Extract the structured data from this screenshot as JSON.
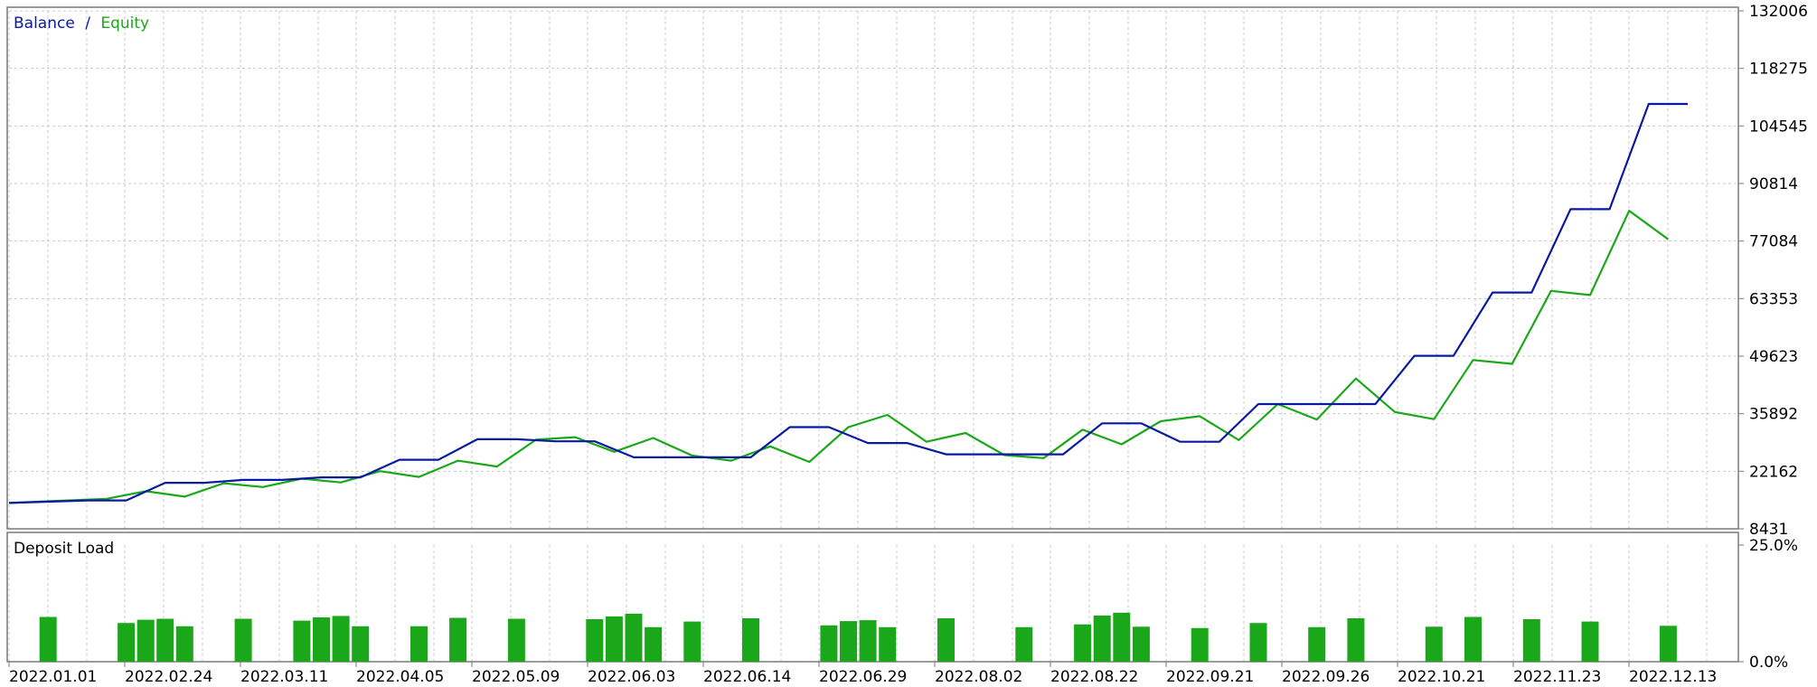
{
  "colors": {
    "balance": "#0a1aa0",
    "equity": "#1aa81a",
    "bar": "#1aa81a",
    "grid": "#c8c8c8",
    "frame": "#7a7a7a",
    "text": "#000000"
  },
  "chart_data": [
    {
      "type": "line",
      "legend": {
        "placement": "top-left",
        "items": [
          {
            "label": "Balance",
            "color": "#0a1aa0"
          },
          {
            "label": "/",
            "color": "#0a1aa0"
          },
          {
            "label": "Equity",
            "color": "#1aa81a"
          }
        ]
      },
      "grid": true,
      "ylim": [
        8431,
        132006
      ],
      "y_ticks": [
        "132006",
        "118275",
        "104545",
        "90814",
        "77084",
        "63353",
        "49623",
        "35892",
        "22162",
        "8431"
      ],
      "x_ticks": [
        "2022.01.01",
        "2022.02.24",
        "2022.03.11",
        "2022.04.05",
        "2022.05.09",
        "2022.06.03",
        "2022.06.14",
        "2022.06.29",
        "2022.08.02",
        "2022.08.22",
        "2022.09.21",
        "2022.09.26",
        "2022.10.21",
        "2022.11.23",
        "2022.12.13"
      ],
      "series": [
        {
          "name": "Balance",
          "x": [
            0,
            4,
            6,
            8,
            10,
            12,
            14,
            16,
            18,
            20,
            22,
            24,
            26,
            28,
            30,
            32,
            34,
            36,
            38,
            40,
            42,
            44,
            46,
            48,
            50,
            52,
            54,
            56,
            58,
            60,
            62,
            64,
            66,
            68,
            70,
            72,
            74,
            76,
            78,
            80,
            82,
            84,
            86
          ],
          "y": [
            14600,
            15200,
            15200,
            19400,
            19400,
            20100,
            20100,
            20700,
            20700,
            24900,
            24900,
            29800,
            29800,
            29300,
            29300,
            25500,
            25500,
            25500,
            25500,
            32700,
            32700,
            28900,
            28900,
            26200,
            26200,
            26200,
            26200,
            33600,
            33600,
            29200,
            29200,
            38200,
            38200,
            38200,
            38200,
            49700,
            49700,
            64800,
            64800,
            84700,
            84700,
            109800,
            109800
          ],
          "color": "#0a1aa0"
        },
        {
          "name": "Equity",
          "x": [
            0,
            2,
            5,
            7,
            9,
            11,
            13,
            15,
            17,
            19,
            21,
            23,
            25,
            27,
            29,
            31,
            33,
            35,
            37,
            39,
            41,
            43,
            45,
            47,
            49,
            51,
            53,
            55,
            57,
            59,
            61,
            63,
            65,
            67,
            69,
            71,
            73,
            75,
            77,
            79,
            81,
            83,
            85
          ],
          "y": [
            14600,
            15000,
            15600,
            17400,
            16100,
            19300,
            18400,
            20400,
            19500,
            22200,
            20800,
            24700,
            23300,
            29700,
            30300,
            26800,
            30100,
            25900,
            24700,
            28100,
            24400,
            32700,
            35600,
            29200,
            31300,
            26000,
            25300,
            32100,
            28600,
            34100,
            35300,
            29600,
            38200,
            34500,
            44300,
            36300,
            34600,
            48700,
            47800,
            65200,
            64200,
            84300,
            77500
          ],
          "color": "#1aa81a"
        }
      ]
    },
    {
      "type": "bar",
      "title": "Deposit Load",
      "ylim": [
        0,
        25
      ],
      "y_ticks": [
        "25.0%",
        "0.0%"
      ],
      "bars": [
        {
          "x": 2,
          "value": 9.6
        },
        {
          "x": 6,
          "value": 8.3
        },
        {
          "x": 7,
          "value": 9.0
        },
        {
          "x": 8,
          "value": 9.2
        },
        {
          "x": 9,
          "value": 7.6
        },
        {
          "x": 12,
          "value": 9.2
        },
        {
          "x": 15,
          "value": 8.8
        },
        {
          "x": 16,
          "value": 9.5
        },
        {
          "x": 17,
          "value": 9.8
        },
        {
          "x": 18,
          "value": 7.6
        },
        {
          "x": 21,
          "value": 7.6
        },
        {
          "x": 23,
          "value": 9.4
        },
        {
          "x": 26,
          "value": 9.2
        },
        {
          "x": 30,
          "value": 9.1
        },
        {
          "x": 31,
          "value": 9.7
        },
        {
          "x": 32,
          "value": 10.3
        },
        {
          "x": 33,
          "value": 7.4
        },
        {
          "x": 35,
          "value": 8.6
        },
        {
          "x": 38,
          "value": 9.3
        },
        {
          "x": 42,
          "value": 7.8
        },
        {
          "x": 43,
          "value": 8.7
        },
        {
          "x": 44,
          "value": 8.9
        },
        {
          "x": 45,
          "value": 7.4
        },
        {
          "x": 48,
          "value": 9.3
        },
        {
          "x": 52,
          "value": 7.4
        },
        {
          "x": 55,
          "value": 8.0
        },
        {
          "x": 56,
          "value": 9.9
        },
        {
          "x": 57,
          "value": 10.5
        },
        {
          "x": 58,
          "value": 7.5
        },
        {
          "x": 61,
          "value": 7.2
        },
        {
          "x": 64,
          "value": 8.3
        },
        {
          "x": 67,
          "value": 7.4
        },
        {
          "x": 69,
          "value": 9.3
        },
        {
          "x": 73,
          "value": 7.5
        },
        {
          "x": 75,
          "value": 9.6
        },
        {
          "x": 78,
          "value": 9.1
        },
        {
          "x": 81,
          "value": 8.6
        },
        {
          "x": 85,
          "value": 7.7
        }
      ]
    }
  ]
}
